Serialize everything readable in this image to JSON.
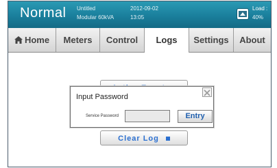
{
  "header": {
    "mode": "Normal",
    "device_line1": "Untitled",
    "device_line2": "Modular 60kVA",
    "date": "2012-09-02",
    "time": "13:05",
    "load_label": "Load :",
    "load_value": "40%",
    "load_icon": "load-indicator-icon"
  },
  "tabs": [
    {
      "label": "Home",
      "icon": "home-icon",
      "active": false
    },
    {
      "label": "Meters",
      "active": false
    },
    {
      "label": "Control",
      "active": false
    },
    {
      "label": "Logs",
      "active": true
    },
    {
      "label": "Settings",
      "active": false
    },
    {
      "label": "About",
      "active": false
    }
  ],
  "content": {
    "background_buttons": [
      {
        "label": "Active Event",
        "icon": "lock-icon"
      },
      {
        "label": "Clear Log",
        "icon": "lock-icon"
      }
    ]
  },
  "dialog": {
    "title": "Input Password",
    "password_label": "Service Password",
    "password_value": "",
    "entry_label": "Entry",
    "close_icon": "close-icon"
  },
  "colors": {
    "header_bg": "#1a7f9c",
    "accent_text": "#2a6fd0"
  }
}
